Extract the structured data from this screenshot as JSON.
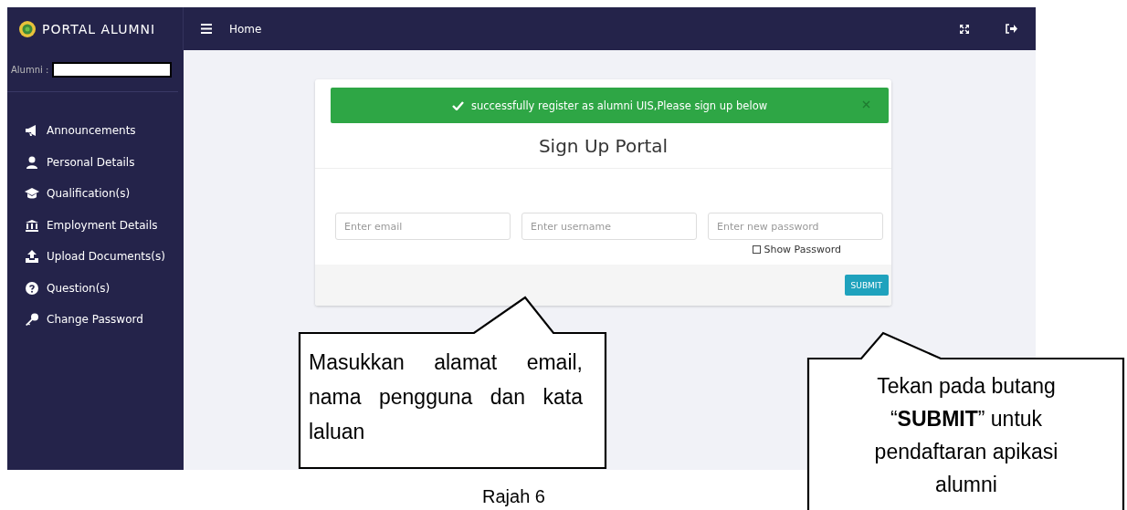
{
  "sidebar": {
    "brand": "PORTAL ALUMNI",
    "user_label": "Alumni :",
    "items": [
      {
        "label": "Announcements"
      },
      {
        "label": "Personal Details"
      },
      {
        "label": "Qualification(s)"
      },
      {
        "label": "Employment Details"
      },
      {
        "label": "Upload Documents(s)"
      },
      {
        "label": "Question(s)"
      },
      {
        "label": "Change Password"
      }
    ]
  },
  "topbar": {
    "title": "Home"
  },
  "alert": {
    "text": "successfully register as alumni UIS,Please sign up below",
    "dismissible": true
  },
  "form": {
    "title": "Sign Up Portal",
    "fields": [
      {
        "placeholder": "Enter email"
      },
      {
        "placeholder": "Enter username"
      },
      {
        "placeholder": "Enter new password"
      }
    ],
    "show_password": {
      "label": "Show Password",
      "checked": false
    },
    "submit": "SUBMIT"
  },
  "callouts": [
    {
      "text": "Masukkan alamat email, nama pengguna dan kata laluan"
    },
    {
      "text": "Tekan pada butang “**SUBMIT**” untuk pendaftaran apikasi alumni"
    }
  ],
  "caption": "Rajah 6"
}
